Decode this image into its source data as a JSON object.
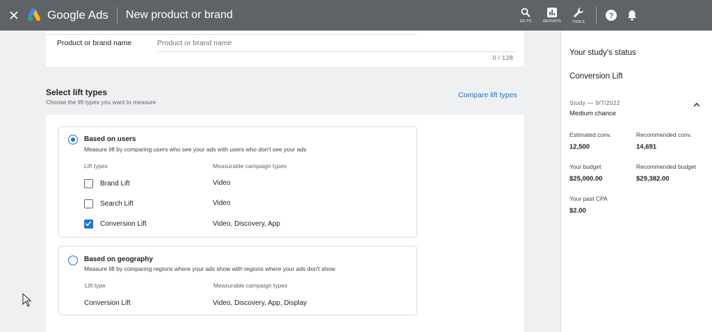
{
  "topbar": {
    "brand": "Google Ads",
    "page_title": "New product or brand",
    "tools": [
      {
        "label": "GO TO",
        "icon": "search-icon"
      },
      {
        "label": "REPORTS",
        "icon": "reports-icon"
      },
      {
        "label": "TOOLS",
        "icon": "wrench-icon"
      }
    ],
    "background": "#5f6368"
  },
  "name_field": {
    "label": "Product or brand name",
    "placeholder": "Product or brand name",
    "value": "",
    "char_count": "0 / 128"
  },
  "lift_section": {
    "title": "Select lift types",
    "subtitle": "Choose the lift types you want to measure",
    "compare_link": "Compare lift types"
  },
  "options": {
    "users": {
      "title": "Based on users",
      "description": "Measure lift by comparing users who see your ads with users who don't see your ads",
      "selected": true,
      "col_type": "Lift types",
      "col_campaigns": "Measurable campaign types",
      "rows": [
        {
          "label": "Brand Lift",
          "campaigns": "Video",
          "checked": false
        },
        {
          "label": "Search Lift",
          "campaigns": "Video",
          "checked": false
        },
        {
          "label": "Conversion Lift",
          "campaigns": "Video, Discovery, App",
          "checked": true
        }
      ]
    },
    "geo": {
      "title": "Based on geography",
      "description": "Measure lift by comparing regions where your ads show with regions where your ads don't show",
      "selected": false,
      "col_type": "Lift type",
      "col_campaigns": "Measurable campaign types",
      "row": {
        "label": "Conversion Lift",
        "campaigns": "Video, Discovery, App, Display"
      }
    }
  },
  "status_panel": {
    "title": "Your study's status",
    "subtitle": "Conversion Lift",
    "study": "Study — 9/7/2022",
    "chance": "Medium chance",
    "metrics": {
      "estimated_conv_label": "Estimated conv.",
      "estimated_conv_value": "12,500",
      "recommended_conv_label": "Recommended conv.",
      "recommended_conv_value": "14,691",
      "budget_label": "Your budget",
      "budget_value": "$25,000.00",
      "recommended_budget_label": "Recommended budget",
      "recommended_budget_value": "$29,382.00",
      "past_cpa_label": "Your past CPA",
      "past_cpa_value": "$2.00"
    }
  },
  "colors": {
    "accent": "#1a73e8",
    "topbar": "#5f6368"
  }
}
